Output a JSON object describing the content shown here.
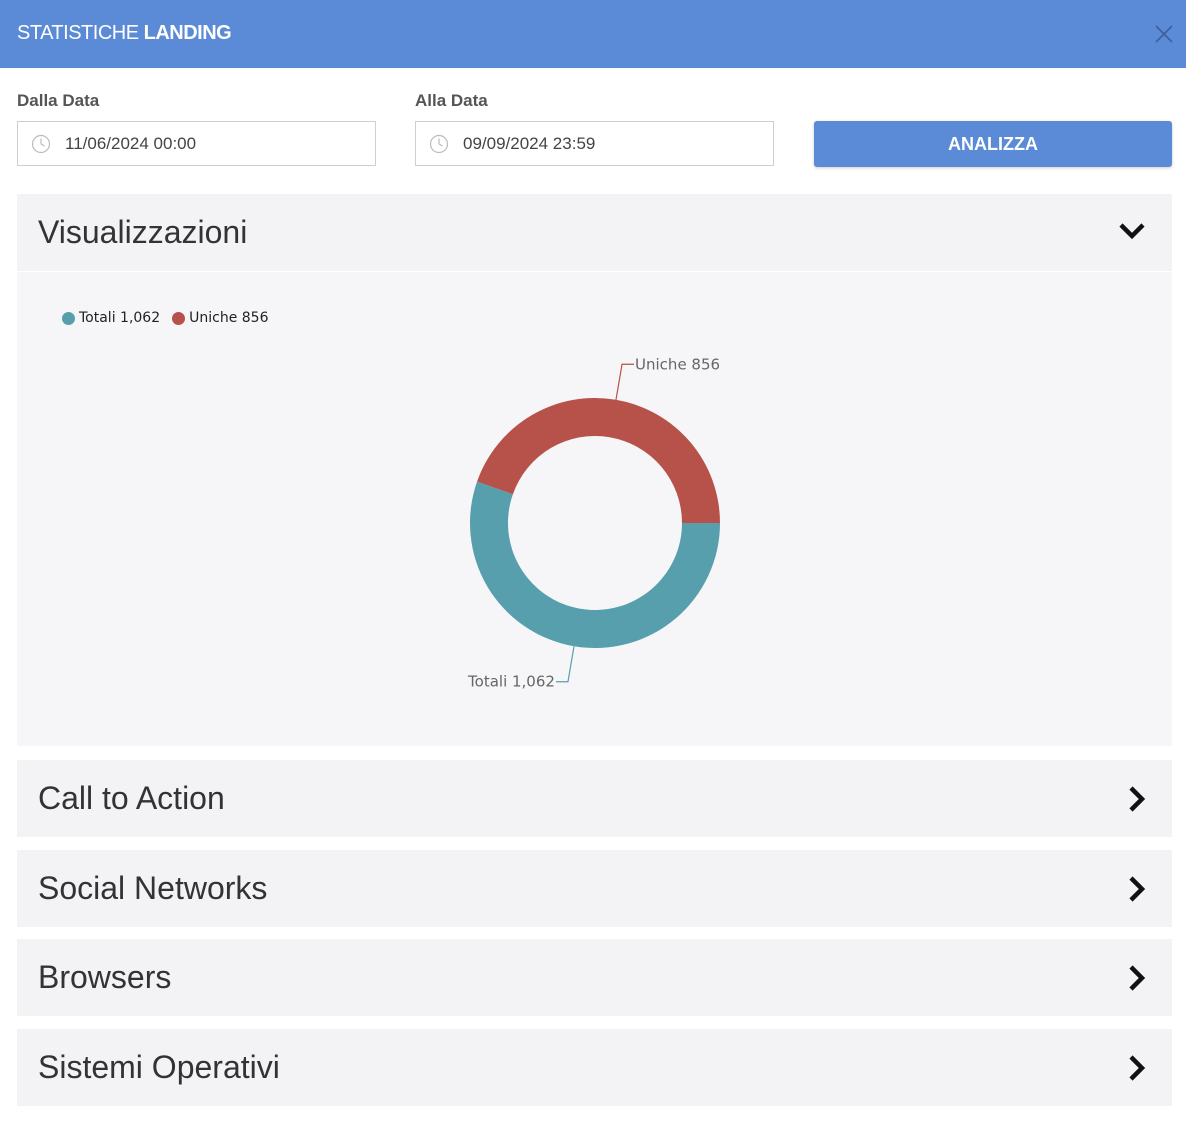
{
  "header": {
    "title_light": "STATISTICHE ",
    "title_bold": "LANDING"
  },
  "filters": {
    "from_label": "Dalla Data",
    "from_value": "11/06/2024 00:00",
    "to_label": "Alla Data",
    "to_value": "09/09/2024 23:59",
    "analyze_label": "ANALIZZA"
  },
  "sections": [
    {
      "title": "Visualizzazioni",
      "expanded": true
    },
    {
      "title": "Call to Action",
      "expanded": false
    },
    {
      "title": "Social Networks",
      "expanded": false
    },
    {
      "title": "Browsers",
      "expanded": false
    },
    {
      "title": "Sistemi Operativi",
      "expanded": false
    }
  ],
  "legend": {
    "totali": "Totali 1,062",
    "uniche": "Uniche 856"
  },
  "chart_data": {
    "type": "pie",
    "donut": true,
    "categories": [
      "Totali",
      "Uniche"
    ],
    "values": [
      1062,
      856
    ],
    "labels": [
      "Totali 1,062",
      "Uniche 856"
    ],
    "colors": [
      "#579fad",
      "#b7524a"
    ],
    "legend_placement": "top-left"
  },
  "colors": {
    "header": "#5b8ad6",
    "button": "#5b8ad6",
    "panel": "#f3f2f5"
  }
}
